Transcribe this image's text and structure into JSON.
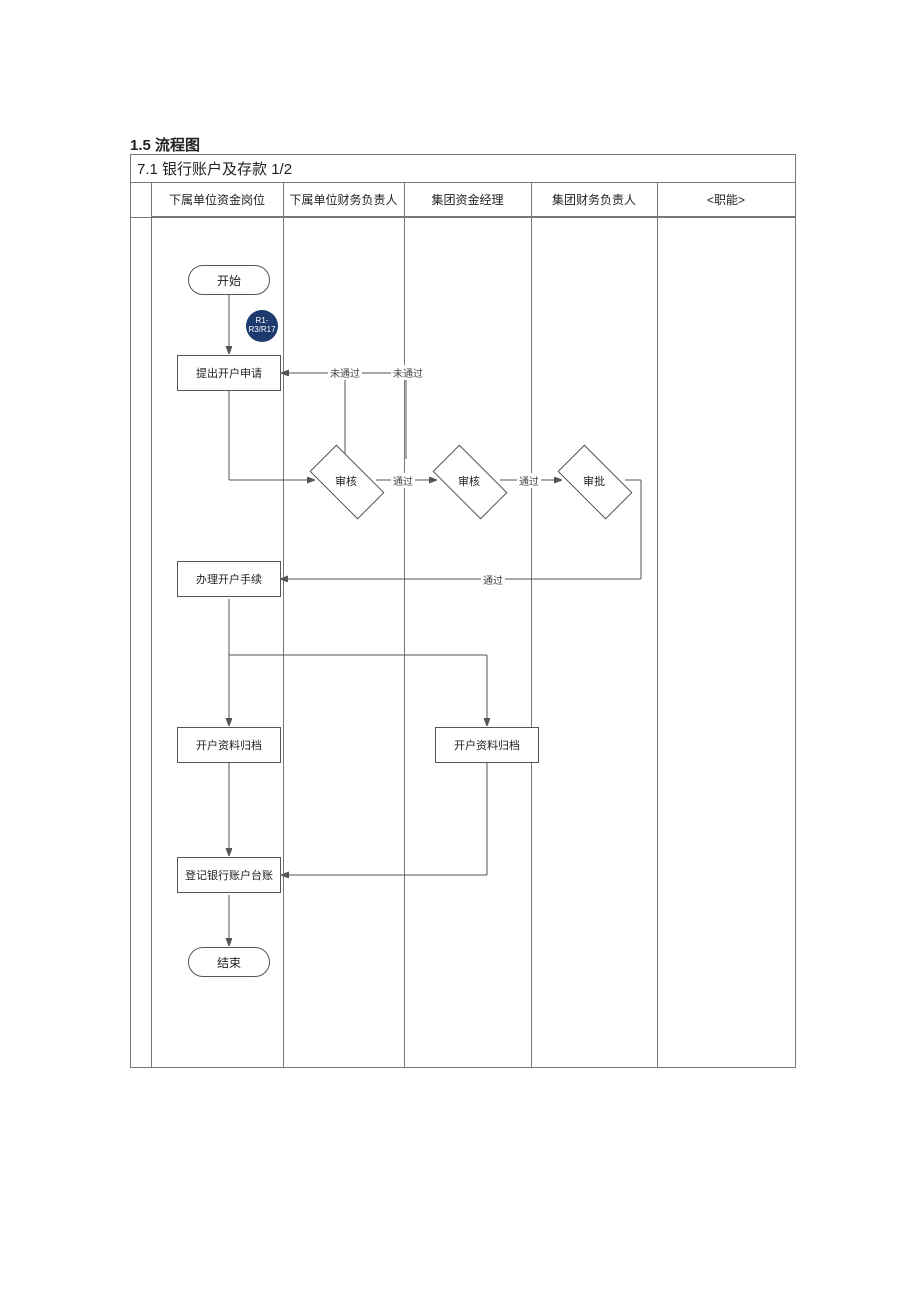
{
  "heading": "1.5 流程图",
  "title": "7.1 银行账户及存款 1/2",
  "lanes": {
    "l1": "下属单位资金岗位",
    "l2": "下属单位财务负责人",
    "l3": "集团资金经理",
    "l4": "集团财务负责人",
    "l5": "<职能>"
  },
  "nodes": {
    "start": "开始",
    "badge": "R1-R3/R17",
    "apply": "提出开户申请",
    "review1": "审核",
    "review2": "审核",
    "approve": "审批",
    "handle": "办理开户手续",
    "archive1": "开户资料归档",
    "archive2": "开户资料归档",
    "ledger": "登记银行账户台账",
    "end": "结束"
  },
  "edges": {
    "fail1": "未通过",
    "fail2": "未通过",
    "pass1": "通过",
    "pass2": "通过",
    "pass3": "通过"
  }
}
